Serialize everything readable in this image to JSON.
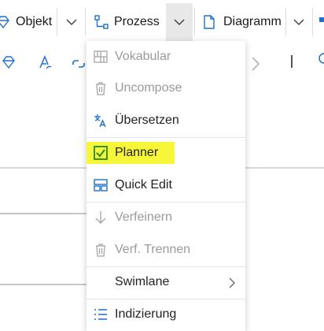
{
  "toolbar": {
    "objekt_label": "Objekt",
    "prozess_label": "Prozess",
    "diagramm_label": "Diagramm"
  },
  "menu": {
    "items": [
      {
        "label": "Vokabular",
        "icon": "vocabulary-grid-icon",
        "disabled": true
      },
      {
        "label": "Uncompose",
        "icon": "trash-icon",
        "disabled": true
      },
      {
        "label": "Übersetzen",
        "icon": "translate-icon",
        "disabled": false
      },
      {
        "label": "Planner",
        "icon": "checkbox-checked-icon",
        "disabled": false,
        "highlighted": true
      },
      {
        "label": "Quick Edit",
        "icon": "quick-edit-icon",
        "disabled": false
      },
      {
        "label": "Verfeinern",
        "icon": "arrow-down-icon",
        "disabled": true
      },
      {
        "label": "Verf. Trennen",
        "icon": "trash-icon",
        "disabled": true
      },
      {
        "label": "Swimlane",
        "icon": "",
        "disabled": false,
        "submenu": true
      },
      {
        "label": "Indizierung",
        "icon": "numbered-list-icon",
        "disabled": false
      }
    ]
  },
  "colors": {
    "accent": "#1f6fd1",
    "highlight": "#f7f73a",
    "planner_green": "#1e8a1e",
    "disabled_text": "#9a9a9a"
  }
}
